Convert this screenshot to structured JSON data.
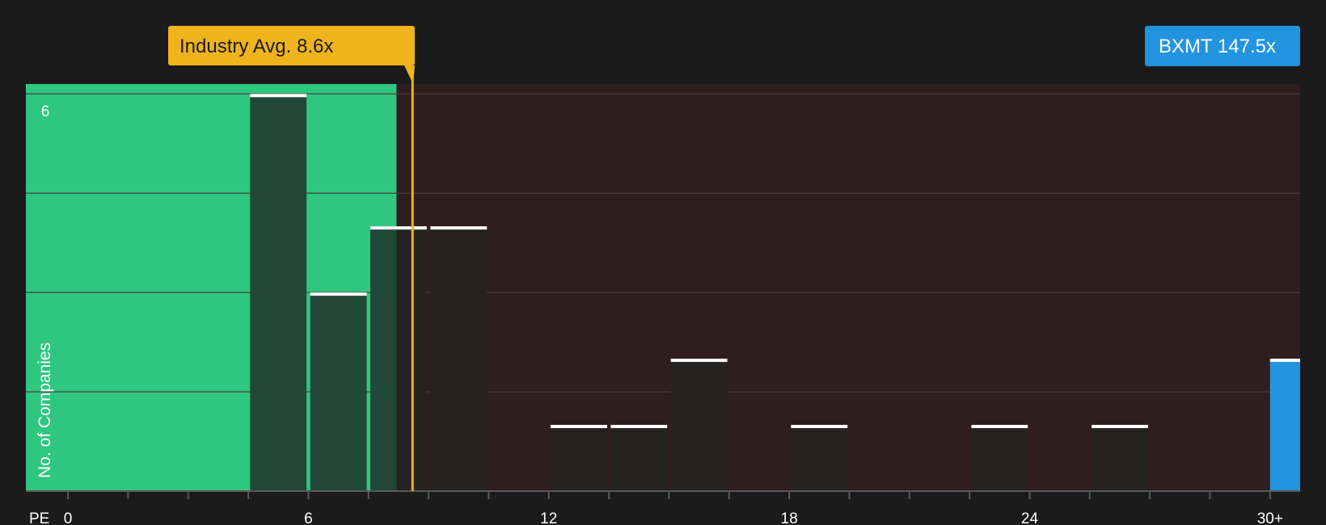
{
  "chart_data": {
    "type": "bar",
    "x_axis_label": "PE",
    "y_axis_label": "No. of Companies",
    "x_tick_labels": [
      "0",
      "6",
      "12",
      "18",
      "24",
      "30+"
    ],
    "x_tick_values": [
      0,
      6,
      12,
      18,
      24,
      30
    ],
    "x_range": [
      -1.05,
      30.75
    ],
    "y_tick_labels": [
      "6"
    ],
    "y_tick_values": [
      6
    ],
    "ylim": [
      0,
      6.15
    ],
    "gridlines_y": [
      1.5,
      3,
      4.5,
      6
    ],
    "bin_width": 1.5,
    "bins": [
      {
        "x_start": 4.5,
        "count": 6
      },
      {
        "x_start": 6.0,
        "count": 3
      },
      {
        "x_start": 7.5,
        "count": 4
      },
      {
        "x_start": 9.0,
        "count": 4
      },
      {
        "x_start": 12.0,
        "count": 1
      },
      {
        "x_start": 13.5,
        "count": 1
      },
      {
        "x_start": 15.0,
        "count": 2
      },
      {
        "x_start": 18.0,
        "count": 1
      },
      {
        "x_start": 22.5,
        "count": 1
      },
      {
        "x_start": 25.5,
        "count": 1
      }
    ],
    "highlight_bin": {
      "x_start": 30.0,
      "x_end": 30.75,
      "count": 2,
      "color": "#2394e0"
    },
    "green_zone_end": 8.2,
    "industry_avg": {
      "label": "Industry Avg. 8.6x",
      "value": 8.6,
      "color": "#efb31c"
    },
    "company": {
      "label": "BXMT 147.5x",
      "value": 147.5,
      "color": "#2394e0"
    },
    "colors": {
      "background": "#1b1b1b",
      "green_zone": "#2fc77f",
      "red_zone": "#2f1e1f",
      "bar_in_green": "#22483a",
      "bar_in_red": "#252222",
      "bar_top": "#ffffff",
      "gridline": "#4a3d3d",
      "axis": "#5a5a5a",
      "text": "#ffffff"
    }
  }
}
